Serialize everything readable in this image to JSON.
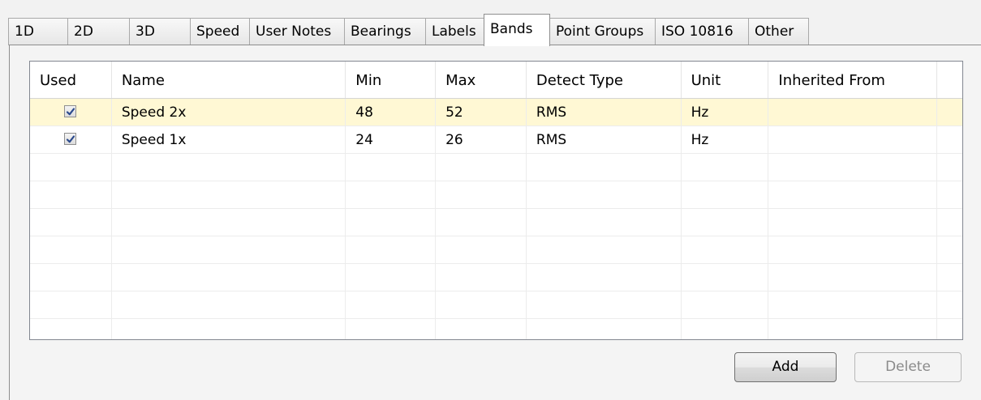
{
  "tabs": [
    {
      "label": "1D",
      "active": false
    },
    {
      "label": "2D",
      "active": false
    },
    {
      "label": "3D",
      "active": false
    },
    {
      "label": "Speed",
      "active": false
    },
    {
      "label": "User Notes",
      "active": false
    },
    {
      "label": "Bearings",
      "active": false
    },
    {
      "label": "Labels",
      "active": false
    },
    {
      "label": "Bands",
      "active": true
    },
    {
      "label": "Point Groups",
      "active": false
    },
    {
      "label": "ISO 10816",
      "active": false
    },
    {
      "label": "Other",
      "active": false
    }
  ],
  "grid": {
    "columns": [
      "Used",
      "Name",
      "Min",
      "Max",
      "Detect Type",
      "Unit",
      "Inherited From"
    ],
    "rows": [
      {
        "used": true,
        "name": "Speed 2x",
        "min": "48",
        "max": "52",
        "detect_type": "RMS",
        "unit": "Hz",
        "inherited_from": ""
      },
      {
        "used": true,
        "name": "Speed 1x",
        "min": "24",
        "max": "26",
        "detect_type": "RMS",
        "unit": "Hz",
        "inherited_from": ""
      }
    ],
    "selected_row_color": "#fff8d4"
  },
  "buttons": {
    "add_label": "Add",
    "delete_label": "Delete"
  }
}
